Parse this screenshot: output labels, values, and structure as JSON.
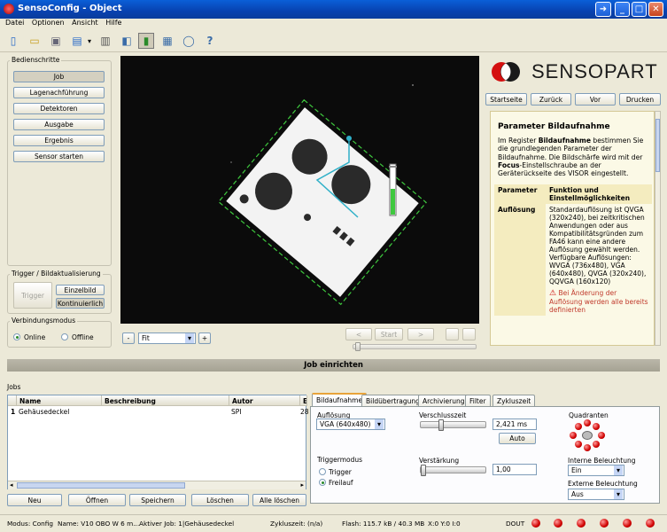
{
  "window": {
    "title": "SensoConfig - Object"
  },
  "menu": [
    "Datei",
    "Optionen",
    "Ansicht",
    "Hilfe"
  ],
  "steps": {
    "group_label": "Bedienschritte",
    "items": [
      "Job",
      "Lagenachführung",
      "Detektoren",
      "Ausgabe",
      "Ergebnis",
      "Sensor starten"
    ]
  },
  "trigger": {
    "group_label": "Trigger / Bildaktualisierung",
    "trigger_button": "Trigger",
    "single_button": "Einzelbild",
    "continuous_button": "Kontinuierlich"
  },
  "connection": {
    "group_label": "Verbindungsmodus",
    "online": "Online",
    "offline": "Offline",
    "selected": "Online"
  },
  "zoom": {
    "minus": "-",
    "value": "Fit",
    "plus": "+"
  },
  "playback": {
    "prev": "<",
    "start": "Start",
    "next": ">"
  },
  "brand": {
    "logo_text": "SENSOPART"
  },
  "nav": {
    "home": "Startseite",
    "back": "Zurück",
    "forward": "Vor",
    "print": "Drucken"
  },
  "help": {
    "title": "Parameter Bildaufnahme",
    "intro_1": "Im Register ",
    "intro_bold": "Bildaufnahme",
    "intro_2": " bestimmen Sie die grundlegenden Parameter der Bildaufnahme. Die Bildschärfe wird mit der ",
    "intro_bold2": "Focus",
    "intro_3": "-Einstellschraube an der Geräterückseite des VISOR eingestellt.",
    "col1": "Parameter",
    "col2": "Funktion und Einstellmöglichkeiten",
    "row_key": "Auflösung",
    "row_text": "Standardauflösung ist QVGA (320x240), bei zeitkritischen Anwendungen oder aus Kompatibilitätsgründen zum FA46 kann eine andere Auflösung gewählt werden. Verfügbare Auflösungen: WVGA (736x480), VGA (640x480), QVGA (320x240), QQVGA (160x120)",
    "warning": "Bei Änderung der Auflösung werden alle bereits definierten"
  },
  "section_title": "Job einrichten",
  "jobs": {
    "label": "Jobs",
    "columns": [
      "Name",
      "Beschreibung",
      "Autor",
      "Er"
    ],
    "rows": [
      {
        "num": "1",
        "name": "Gehäusedeckel",
        "desc": "",
        "author": "SPI",
        "date": "28"
      }
    ],
    "buttons": [
      "Neu",
      "Öffnen",
      "Speichern",
      "Löschen",
      "Alle löschen"
    ]
  },
  "tabs": [
    "Bildaufnahme",
    "Bildübertragung",
    "Archivierung",
    "Filter",
    "Zykluszeit"
  ],
  "capture": {
    "resolution_label": "Auflösung",
    "resolution_value": "VGA (640x480)",
    "shutter_label": "Verschlusszeit",
    "shutter_value": "2,421 ms",
    "shutter_fraction": 0.3,
    "auto_button": "Auto",
    "gain_label": "Verstärkung",
    "gain_value": "1,00",
    "gain_fraction": 0.0,
    "trigger_mode_label": "Triggermodus",
    "trigger_option": "Trigger",
    "freerun_option": "Freilauf",
    "trigger_selected": "Freilauf",
    "quadrants_label": "Quadranten",
    "internal_light_label": "Interne Beleuchtung",
    "internal_light_value": "Ein",
    "external_light_label": "Externe Beleuchtung",
    "external_light_value": "Aus"
  },
  "status": {
    "mode": "Modus:  Config",
    "name": "Name:  V10 OBO W 6 m...",
    "active_job": "Aktiver Job:  1|Gehäusedeckel",
    "cycle": "Zykluszeit:  (n/a)",
    "flash": "Flash:  115.7 kB / 40.3 MB",
    "xy": "X:0 Y:0 I:0",
    "dout": "DOUT"
  },
  "colors": {
    "accent": "#e8a33a",
    "led": "#d00000",
    "title_blue": "#0842b0",
    "roi_green": "#3ec83e",
    "vector_cyan": "#2fb0c8"
  }
}
